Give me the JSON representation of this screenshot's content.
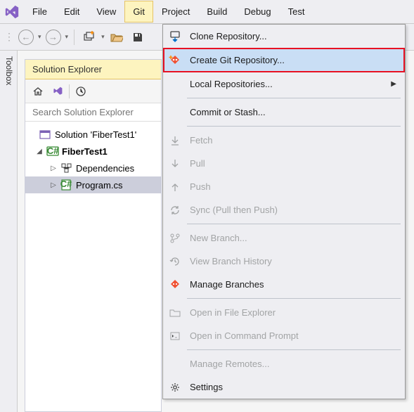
{
  "menubar": {
    "file": "File",
    "edit": "Edit",
    "view": "View",
    "git": "Git",
    "project": "Project",
    "build": "Build",
    "debug": "Debug",
    "test": "Test"
  },
  "toolbox": {
    "label": "Toolbox"
  },
  "solution_explorer": {
    "title": "Solution Explorer",
    "search_placeholder": "Search Solution Explorer",
    "solution": "Solution 'FiberTest1'",
    "project": "FiberTest1",
    "dependencies": "Dependencies",
    "program": "Program.cs"
  },
  "git_menu": {
    "clone": "Clone Repository...",
    "create": "Create Git Repository...",
    "local_repos": "Local Repositories...",
    "commit": "Commit or Stash...",
    "fetch": "Fetch",
    "pull": "Pull",
    "push": "Push",
    "sync": "Sync (Pull then Push)",
    "new_branch": "New Branch...",
    "history": "View Branch History",
    "manage_branches": "Manage Branches",
    "open_explorer": "Open in File Explorer",
    "open_cmd": "Open in Command Prompt",
    "manage_remotes": "Manage Remotes...",
    "settings": "Settings"
  }
}
